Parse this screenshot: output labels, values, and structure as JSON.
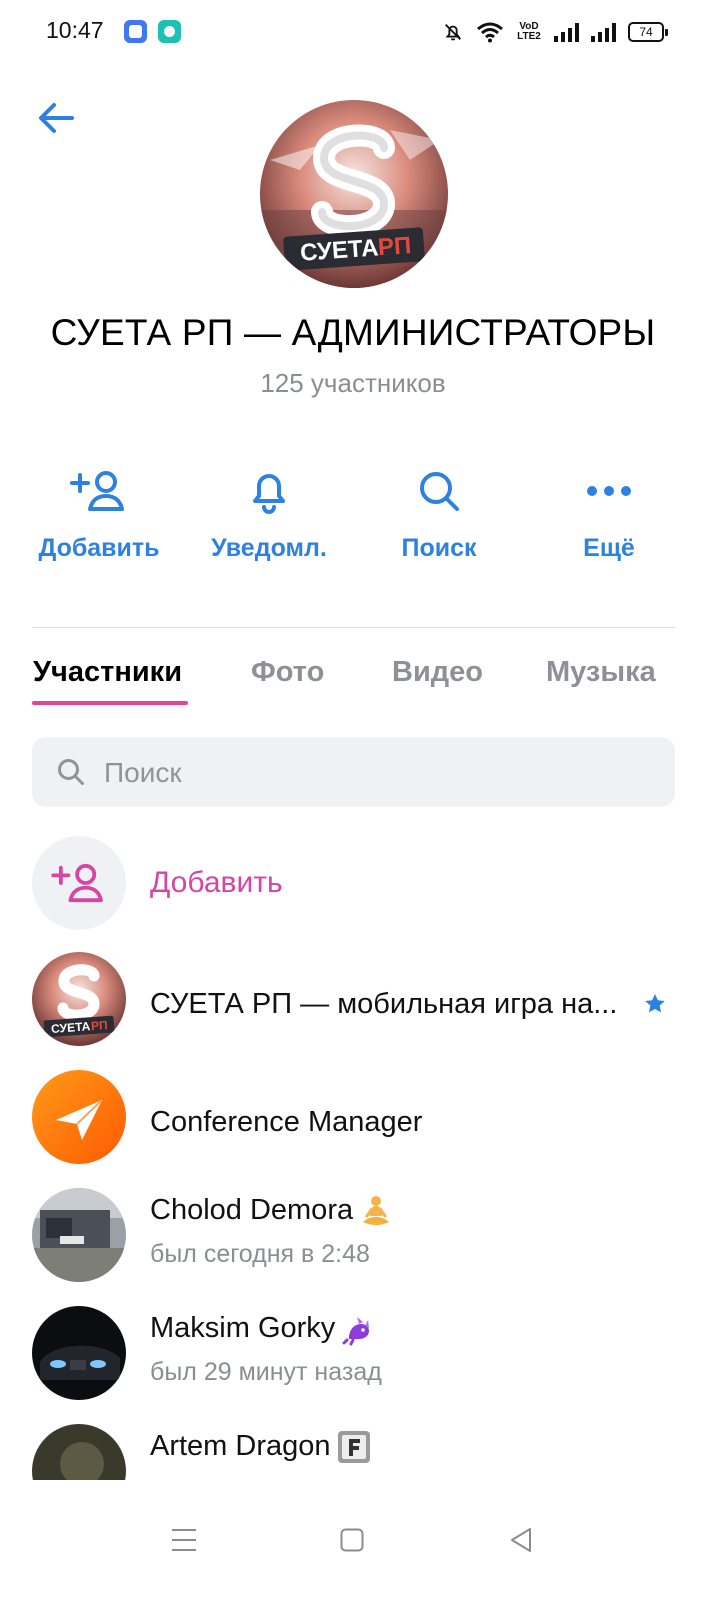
{
  "status_bar": {
    "time": "10:47",
    "network_label_top": "VoD",
    "network_label_bottom": "LTE2",
    "battery": "74"
  },
  "header": {
    "title": "СУЕТА РП — АДМИНИСТРАТОРЫ",
    "subtitle": "125 участников",
    "cover_logo_text_white": "СУЕТА",
    "cover_logo_text_accent": "РП"
  },
  "actions": [
    {
      "label": "Добавить",
      "icon": "add-user-icon"
    },
    {
      "label": "Уведомл.",
      "icon": "bell-icon"
    },
    {
      "label": "Поиск",
      "icon": "search-icon"
    },
    {
      "label": "Ещё",
      "icon": "more-icon"
    }
  ],
  "tabs": [
    {
      "label": "Участники",
      "active": true
    },
    {
      "label": "Фото",
      "active": false
    },
    {
      "label": "Видео",
      "active": false
    },
    {
      "label": "Музыка",
      "active": false
    }
  ],
  "search": {
    "placeholder": "Поиск"
  },
  "add_member": {
    "label": "Добавить"
  },
  "members": [
    {
      "name": "СУЕТА РП — мобильная игра на...",
      "status": "",
      "badge": "star-icon",
      "avatar_logo_white": "СУЕТА",
      "avatar_logo_accent": "РП"
    },
    {
      "name": "Conference Manager",
      "status": ""
    },
    {
      "name": "Cholod Demora",
      "status": "был сегодня в 2:48",
      "emoji": "meditation-emoji"
    },
    {
      "name": "Maksim Gorky",
      "status": "был 29 минут назад",
      "emoji": "dragon-emoji"
    },
    {
      "name": "Artem Dragon",
      "status": "",
      "emoji": "f-square-emoji"
    }
  ],
  "colors": {
    "accent_blue": "#2d81e0",
    "accent_pink": "#d844a6",
    "tab_underline": "#e0449e",
    "muted_text": "#8a8d92"
  }
}
